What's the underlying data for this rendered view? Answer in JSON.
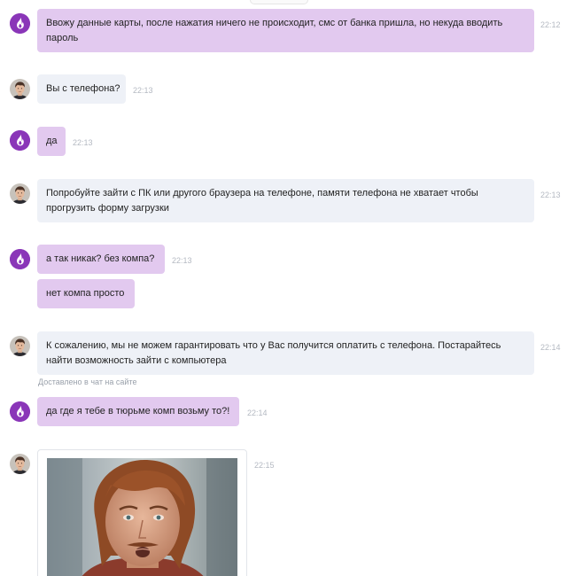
{
  "messages": [
    {
      "sender": "user",
      "text_line1": "Ввожу данные карты, после нажатия ничего не происходит, смс от банка пришла, но некуда вводить",
      "text_line2": "пароль",
      "time": "22:12"
    },
    {
      "sender": "operator",
      "text": "Вы с телефона?",
      "time": "22:13"
    },
    {
      "sender": "user",
      "text": "да",
      "time": "22:13"
    },
    {
      "sender": "operator",
      "text_line1": "Попробуйте зайти с ПК или другого браузера на телефоне, памяти телефона не хватает чтобы",
      "text_line2": "прогрузить форму загрузки",
      "time": "22:13"
    },
    {
      "sender": "user",
      "text": "а так никак? без компа?",
      "time": "22:13"
    },
    {
      "sender": "user",
      "text": "нет компа просто"
    },
    {
      "sender": "operator",
      "text_line1": "К сожалению, мы не можем гарантировать что у Вас получится оплатить с телефона. Постарайтесь",
      "text_line2": "найти возможность зайти с компьютера",
      "time": "22:14"
    },
    {
      "sender": "user",
      "text": "да где я тебе в тюрьме комп возьму то?!",
      "time": "22:14"
    },
    {
      "sender": "operator",
      "type": "image",
      "time": "22:15"
    }
  ],
  "delivered_note": "Доставлено в чат на сайте",
  "colors": {
    "user_bubble": "#e2c9ef",
    "operator_bubble": "#eef1f7",
    "user_avatar": "#8a36b8",
    "timestamp": "#b4b9c2"
  },
  "icons": {
    "user_avatar": "flame-logo-icon",
    "operator_avatar": "operator-photo-avatar"
  }
}
